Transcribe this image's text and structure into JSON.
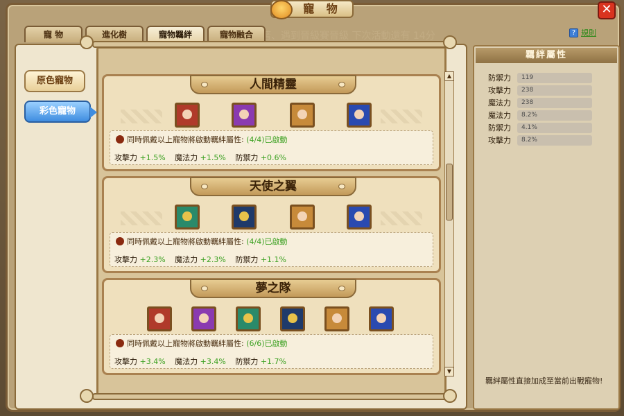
{
  "window": {
    "title": "寵 物",
    "close_label": "✕"
  },
  "marquee": "某著、遇到晉級賽晉級 下次活動還有 14分",
  "tabs": [
    "寵 物",
    "進化樹",
    "寵物羈絆",
    "寵物融合"
  ],
  "active_tab": 2,
  "help": {
    "icon": "?",
    "label": "規則"
  },
  "side_buttons": [
    "原色寵物",
    "彩色寵物"
  ],
  "active_side": 1,
  "groups": [
    {
      "name": "人間精靈",
      "note": "同時佩戴以上寵物將啟動羈絆屬性:",
      "status": "(4/4)已啟動",
      "stats": [
        [
          "攻擊力",
          "+1.5%"
        ],
        [
          "魔法力",
          "+1.5%"
        ],
        [
          "防禦力",
          "+0.6%"
        ]
      ],
      "pets": [
        "pink-hair-pet",
        "purple-hair-pet",
        "fox-pet",
        "blue-hair-pet"
      ]
    },
    {
      "name": "天使之翼",
      "note": "同時佩戴以上寵物將啟動羈絆屬性:",
      "status": "(4/4)已啟動",
      "stats": [
        [
          "攻擊力",
          "+2.3%"
        ],
        [
          "魔法力",
          "+2.3%"
        ],
        [
          "防禦力",
          "+1.1%"
        ]
      ],
      "pets": [
        "green-bird-pet",
        "navy-bird-pet",
        "fox-pet",
        "blue-hair-pet"
      ]
    },
    {
      "name": "夢之隊",
      "note": "同時佩戴以上寵物將啟動羈絆屬性:",
      "status": "(6/6)已啟動",
      "stats": [
        [
          "攻擊力",
          "+3.4%"
        ],
        [
          "魔法力",
          "+3.4%"
        ],
        [
          "防禦力",
          "+1.7%"
        ]
      ],
      "pets": [
        "pink-hair-pet",
        "purple-hair-pet",
        "green-bird-pet",
        "navy-bird-pet",
        "fox-pet",
        "blue-hair-pet"
      ]
    }
  ],
  "right_panel": {
    "title": "羈絆屬性",
    "attrs": [
      {
        "k": "防禦力",
        "v": "119"
      },
      {
        "k": "攻擊力",
        "v": "238"
      },
      {
        "k": "魔法力",
        "v": "238"
      },
      {
        "k": "魔法力",
        "v": "8.2%"
      },
      {
        "k": "防禦力",
        "v": "4.1%"
      },
      {
        "k": "攻擊力",
        "v": "8.2%"
      }
    ],
    "note": "羈絆屬性直接加成至當前出戰寵物!"
  },
  "colors": {
    "accent_blue": "#3f8de0",
    "active_green": "#3aa020",
    "frame_brown": "#7a5c36"
  }
}
